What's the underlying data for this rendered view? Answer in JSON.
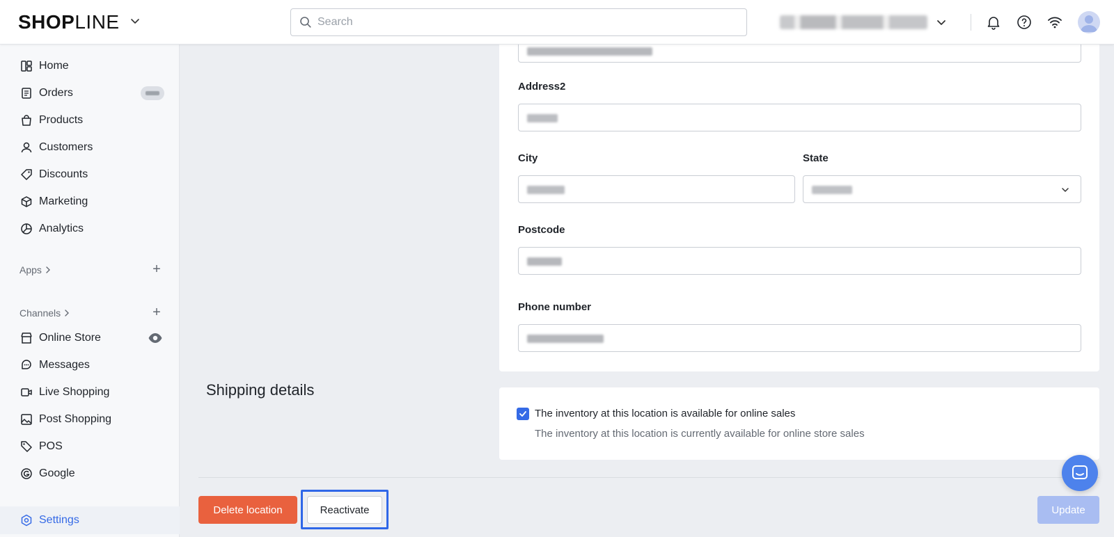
{
  "header": {
    "brand_bold": "SHOP",
    "brand_light": "LINE",
    "search_placeholder": "Search"
  },
  "sidebar": {
    "items": [
      {
        "label": "Home",
        "icon": "home-icon"
      },
      {
        "label": "Orders",
        "icon": "orders-icon"
      },
      {
        "label": "Products",
        "icon": "bag-icon"
      },
      {
        "label": "Customers",
        "icon": "person-icon"
      },
      {
        "label": "Discounts",
        "icon": "tag-icon"
      },
      {
        "label": "Marketing",
        "icon": "cube-icon"
      },
      {
        "label": "Analytics",
        "icon": "pie-icon"
      }
    ],
    "apps_label": "Apps",
    "channels_label": "Channels",
    "channels": [
      {
        "label": "Online Store",
        "icon": "store-icon"
      },
      {
        "label": "Messages",
        "icon": "chat-icon"
      },
      {
        "label": "Live Shopping",
        "icon": "video-icon"
      },
      {
        "label": "Post Shopping",
        "icon": "image-icon"
      },
      {
        "label": "POS",
        "icon": "pos-tag-icon"
      },
      {
        "label": "Google",
        "icon": "google-icon"
      }
    ],
    "settings_label": "Settings"
  },
  "form": {
    "address2_label": "Address2",
    "city_label": "City",
    "state_label": "State",
    "postcode_label": "Postcode",
    "phone_label": "Phone number"
  },
  "shipping": {
    "title": "Shipping details",
    "checkbox_checked": true,
    "checkbox_label": "The inventory at this location is available for online sales",
    "checkbox_help": "The inventory at this location is currently available for online store sales"
  },
  "footer": {
    "delete_label": "Delete location",
    "reactivate_label": "Reactivate",
    "update_label": "Update"
  },
  "colors": {
    "accent": "#356ae6",
    "danger": "#e9613e",
    "primary_disabled": "#a9bdf2",
    "highlight": "#2f67e8"
  }
}
